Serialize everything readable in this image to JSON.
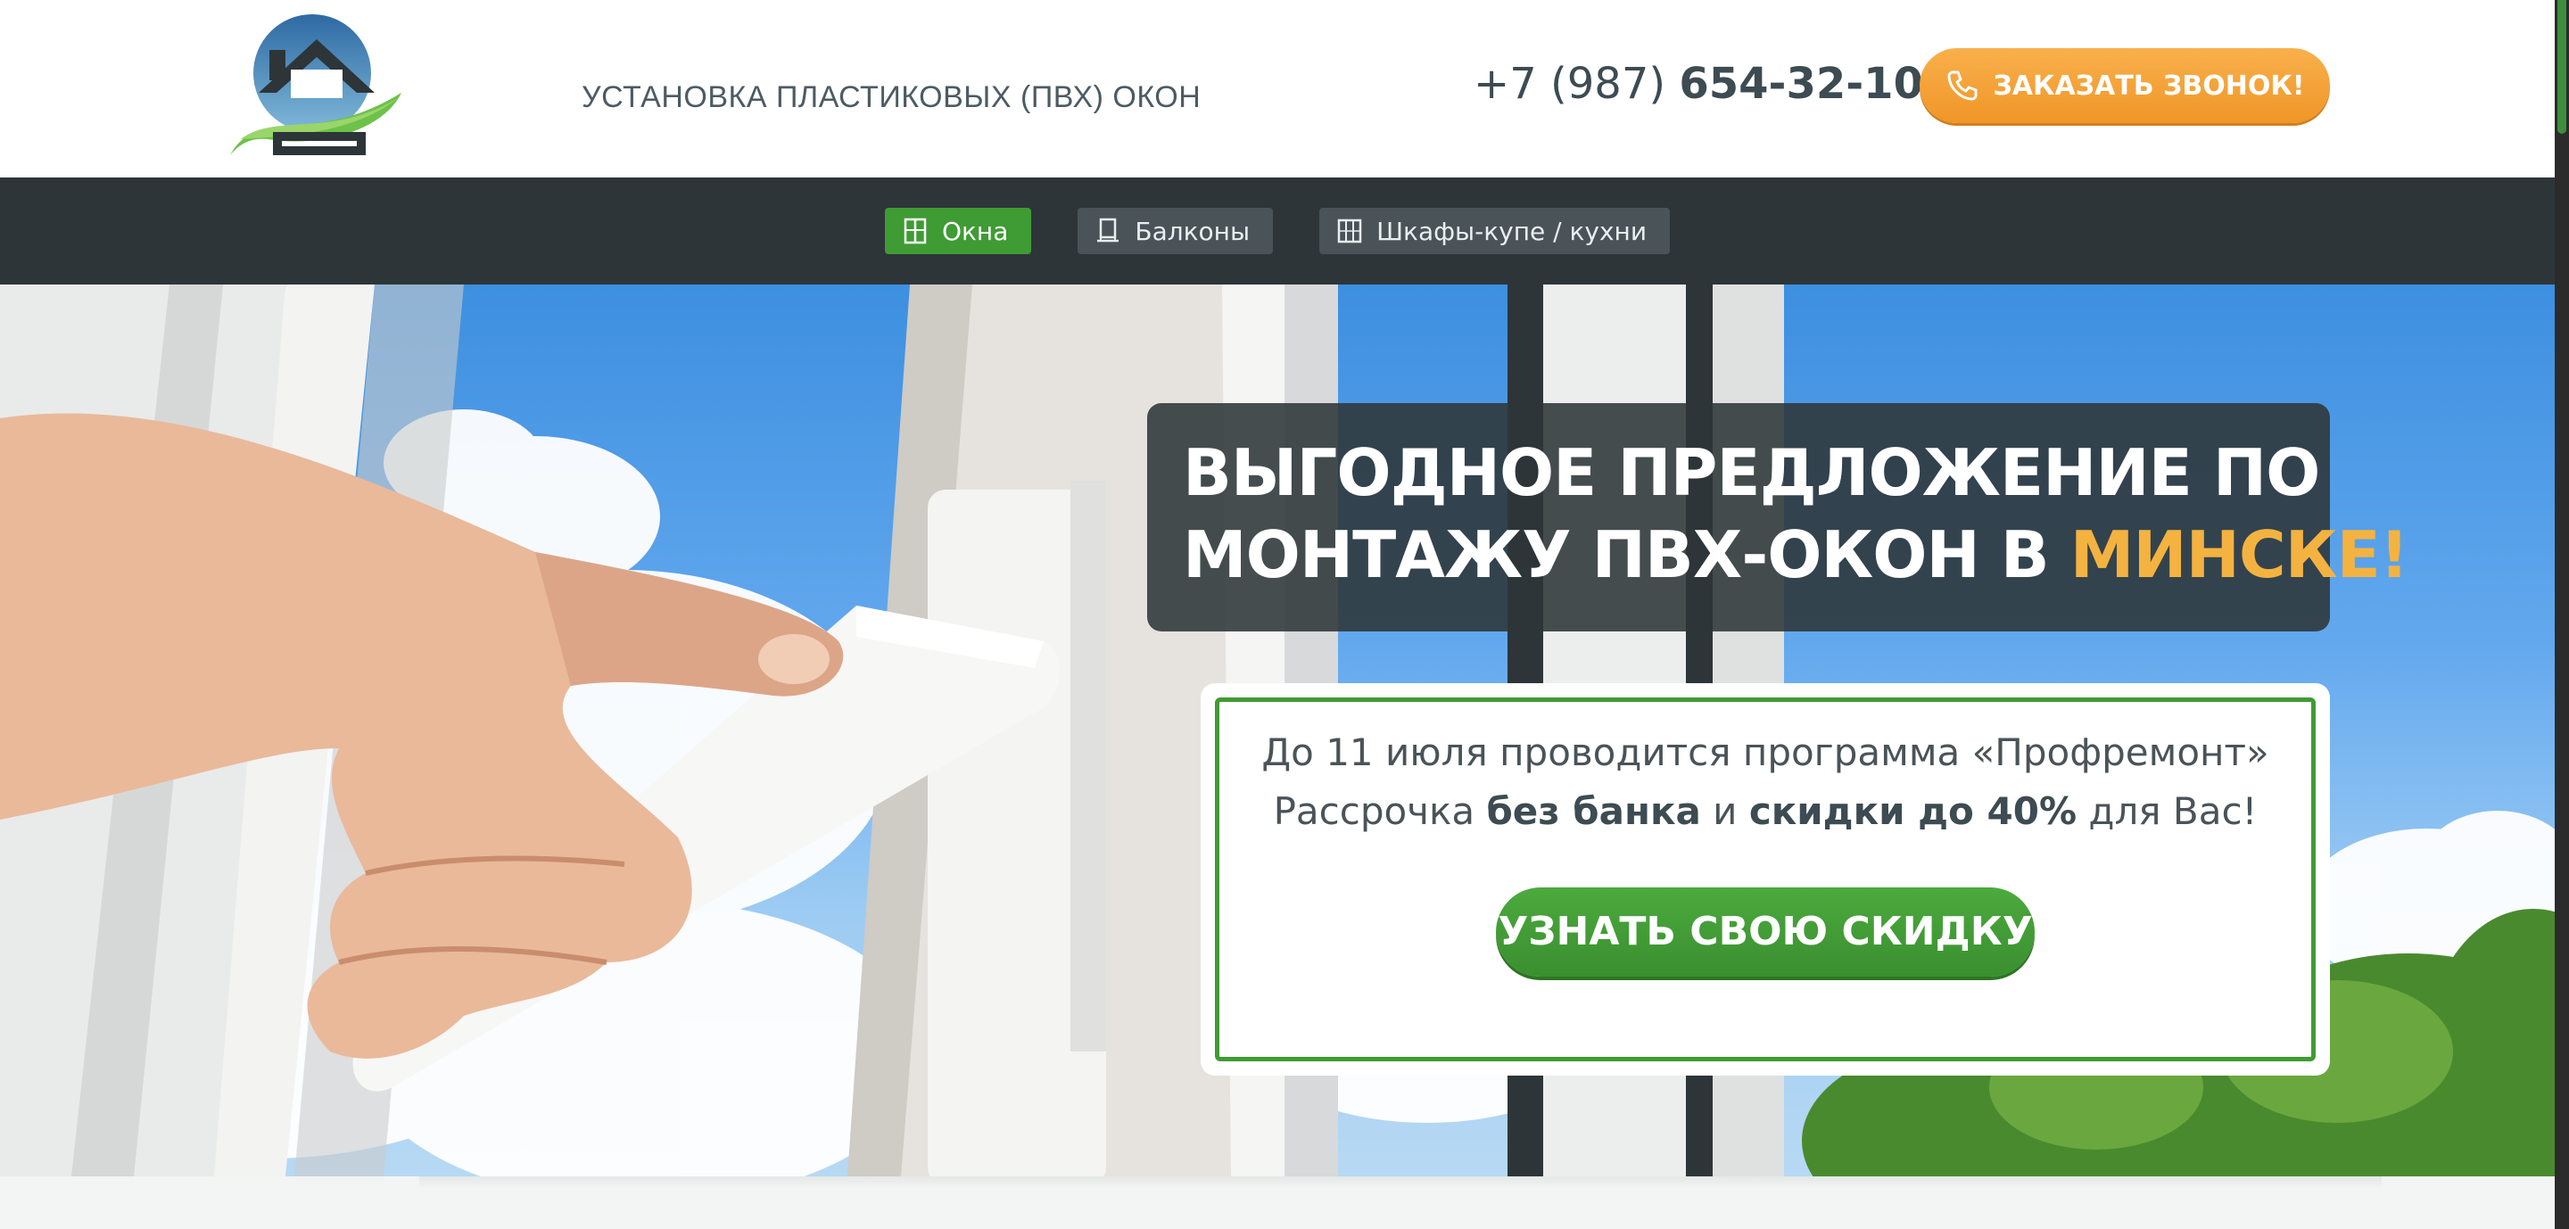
{
  "header": {
    "tagline": "УСТАНОВКА ПЛАСТИКОВЫХ (ПВХ) ОКОН",
    "phone_prefix": "+7 (987) ",
    "phone_main": "654-32-10",
    "call_button_label": "ЗАКАЗАТЬ ЗВОНОК!",
    "call_button_icon": "phone-icon",
    "logo_icon": "house-logo-icon"
  },
  "nav": {
    "items": [
      {
        "label": "Окна",
        "icon": "window-icon",
        "active": true
      },
      {
        "label": "Балконы",
        "icon": "balcony-icon",
        "active": false
      },
      {
        "label": "Шкафы-купе / кухни",
        "icon": "wardrobe-icon",
        "active": false
      }
    ]
  },
  "hero": {
    "headline_line1": "ВЫГОДНОЕ ПРЕДЛОЖЕНИЕ ПО",
    "headline_line2_prefix": "МОНТАЖУ ПВХ-ОКОН В ",
    "headline_line2_accent": "МИНСКЕ!",
    "offer_line1": "До 11 июля проводится программа «Профремонт»",
    "offer_line2_part1": "Рассрочка ",
    "offer_line2_bold1": "без банка",
    "offer_line2_part2": " и ",
    "offer_line2_bold2": "скидки до 40%",
    "offer_line2_part3": " для Вас!",
    "cta_label": "УЗНАТЬ СВОЮ СКИДКУ"
  },
  "colors": {
    "brand_green": "#3f9b33",
    "accent_orange": "#f4b340",
    "nav_bg": "#2d3538",
    "text_dark": "#3d4b52"
  }
}
